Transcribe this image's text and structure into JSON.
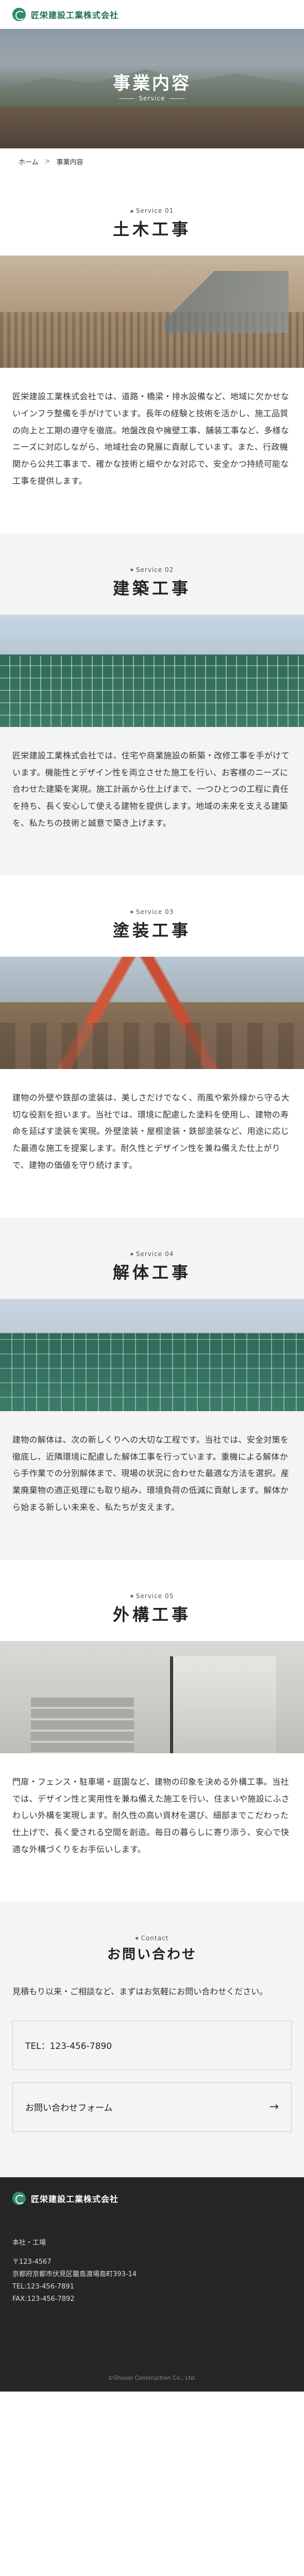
{
  "header": {
    "company": "匠栄建設工業株式会社"
  },
  "hero": {
    "title": "事業内容",
    "subtitle": "Service"
  },
  "breadcrumb": {
    "home": "ホーム",
    "separator": ">",
    "current": "事業内容"
  },
  "services": [
    {
      "label": "Service 01",
      "title": "土木工事",
      "body": "匠栄建設工業株式会社では、道路・橋梁・排水設備など、地域に欠かせないインフラ整備を手がけています。長年の経験と技術を活かし、施工品質の向上と工期の遵守を徹底。地盤改良や擁壁工事、舗装工事など、多様なニーズに対応しながら、地域社会の発展に貢献しています。また、行政機関から公共工事まで、確かな技術と細やかな対応で、安全かつ持続可能な工事を提供します。"
    },
    {
      "label": "Service 02",
      "title": "建築工事",
      "body": "匠栄建設工業株式会社では、住宅や商業施設の新築・改修工事を手がけています。機能性とデザイン性を両立させた施工を行い、お客様のニーズに合わせた建築を実現。施工計画から仕上げまで、一つひとつの工程に責任を持ち、長く安心して使える建物を提供します。地域の未来を支える建築を、私たちの技術と誠意で築き上げます。"
    },
    {
      "label": "Service 03",
      "title": "塗装工事",
      "body": "建物の外壁や鉄部の塗装は、美しさだけでなく、雨風や紫外線から守る大切な役割を担います。当社では、環境に配慮した塗料を使用し、建物の寿命を延ばす塗装を実現。外壁塗装・屋根塗装・鉄部塗装など、用途に応じた最適な施工を提案します。耐久性とデザイン性を兼ね備えた仕上がりで、建物の価値を守り続けます。"
    },
    {
      "label": "Service 04",
      "title": "解体工事",
      "body": "建物の解体は、次の新しくりへの大切な工程です。当社では、安全対策を徹底し、近隣環境に配慮した解体工事を行っています。重機による解体から手作業での分別解体まで、現場の状況に合わせた最適な方法を選択。産業廃棄物の適正処理にも取り組み、環境負荷の低減に貢献します。解体から始まる新しい未来を、私たちが支えます。"
    },
    {
      "label": "Service 05",
      "title": "外構工事",
      "body": "門扉・フェンス・駐車場・庭園など、建物の印象を決める外構工事。当社では、デザイン性と実用性を兼ね備えた施工を行い、住まいや施設にふさわしい外構を実現します。耐久性の高い資材を選び、細部までこだわった仕上げで、長く愛される空間を創造。毎日の暮らしに寄り添う、安心で快適な外構づくりをお手伝いします。"
    }
  ],
  "contact": {
    "label": "Contact",
    "title": "お問い合わせ",
    "text": "見積もり以来・ご相談など、まずはお気軽にお問い合わせください。",
    "tel_label": "TEL：123-456-7890",
    "form_label": "お問い合わせフォーム",
    "form_arrow": "→"
  },
  "footer": {
    "company": "匠栄建設工業株式会社",
    "office_heading": "本社・工場",
    "postal": "〒123-4567",
    "address": "京都府京都市伏見区籠島渡場島町393-14",
    "tel": "TEL:123-456-7891",
    "fax": "FAX:123-456-7892",
    "copyright": "©Shouei Construction Co., Ltd."
  }
}
